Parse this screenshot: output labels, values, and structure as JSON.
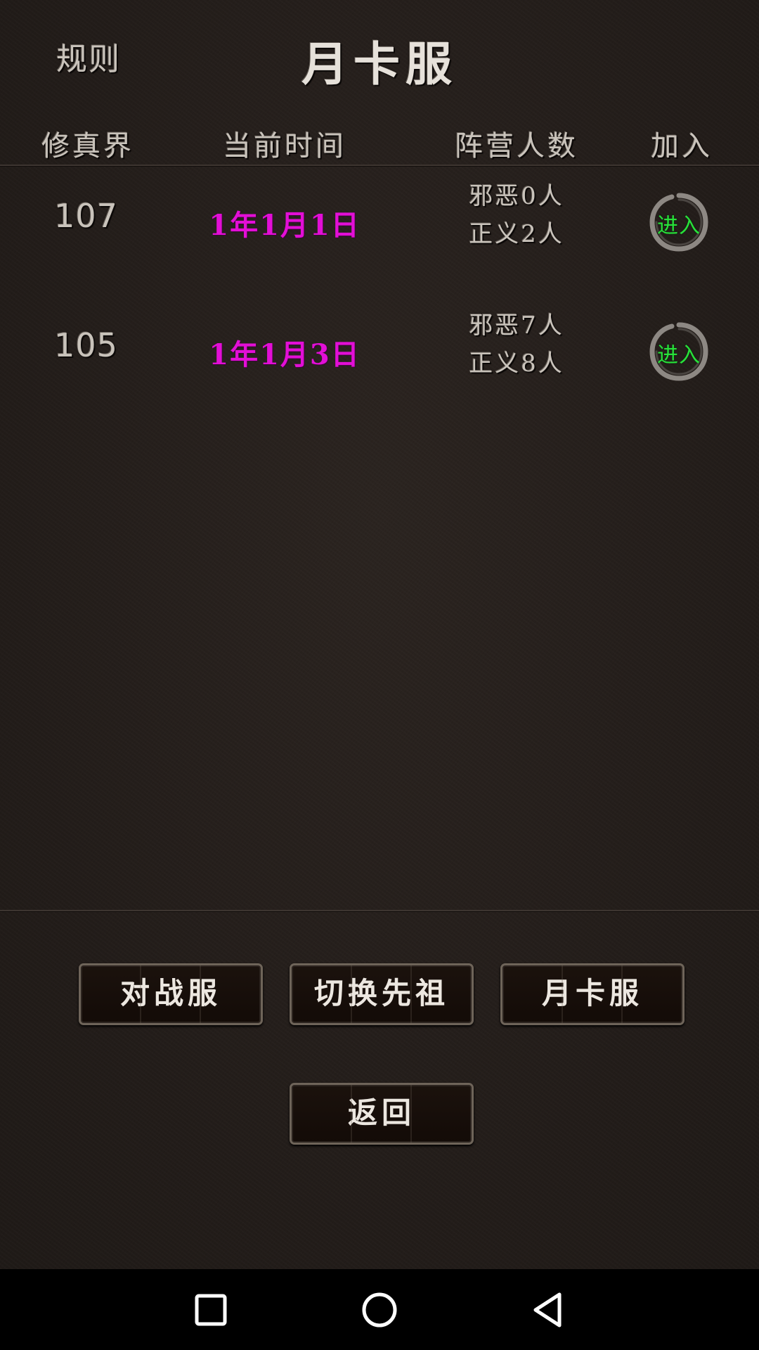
{
  "header": {
    "rules_label": "规则",
    "title": "月卡服"
  },
  "columns": {
    "realm": "修真界",
    "current_time": "当前时间",
    "camp_count": "阵营人数",
    "join": "加入"
  },
  "servers": [
    {
      "realm": "107",
      "time": "1年1月1日",
      "evil": "邪恶0人",
      "justice": "正义2人",
      "enter_label": "进入"
    },
    {
      "realm": "105",
      "time": "1年1月3日",
      "evil": "邪恶7人",
      "justice": "正义8人",
      "enter_label": "进入"
    }
  ],
  "buttons": {
    "battle_server": "对战服",
    "switch_ancestor": "切换先祖",
    "monthly_server": "月卡服",
    "back": "返回"
  },
  "navbar": {
    "icons": [
      "recent-apps-icon",
      "home-icon",
      "back-icon"
    ]
  },
  "colors": {
    "time_text": "#e20fd6",
    "enter_text": "#28e23a",
    "background": "#231d1a"
  }
}
